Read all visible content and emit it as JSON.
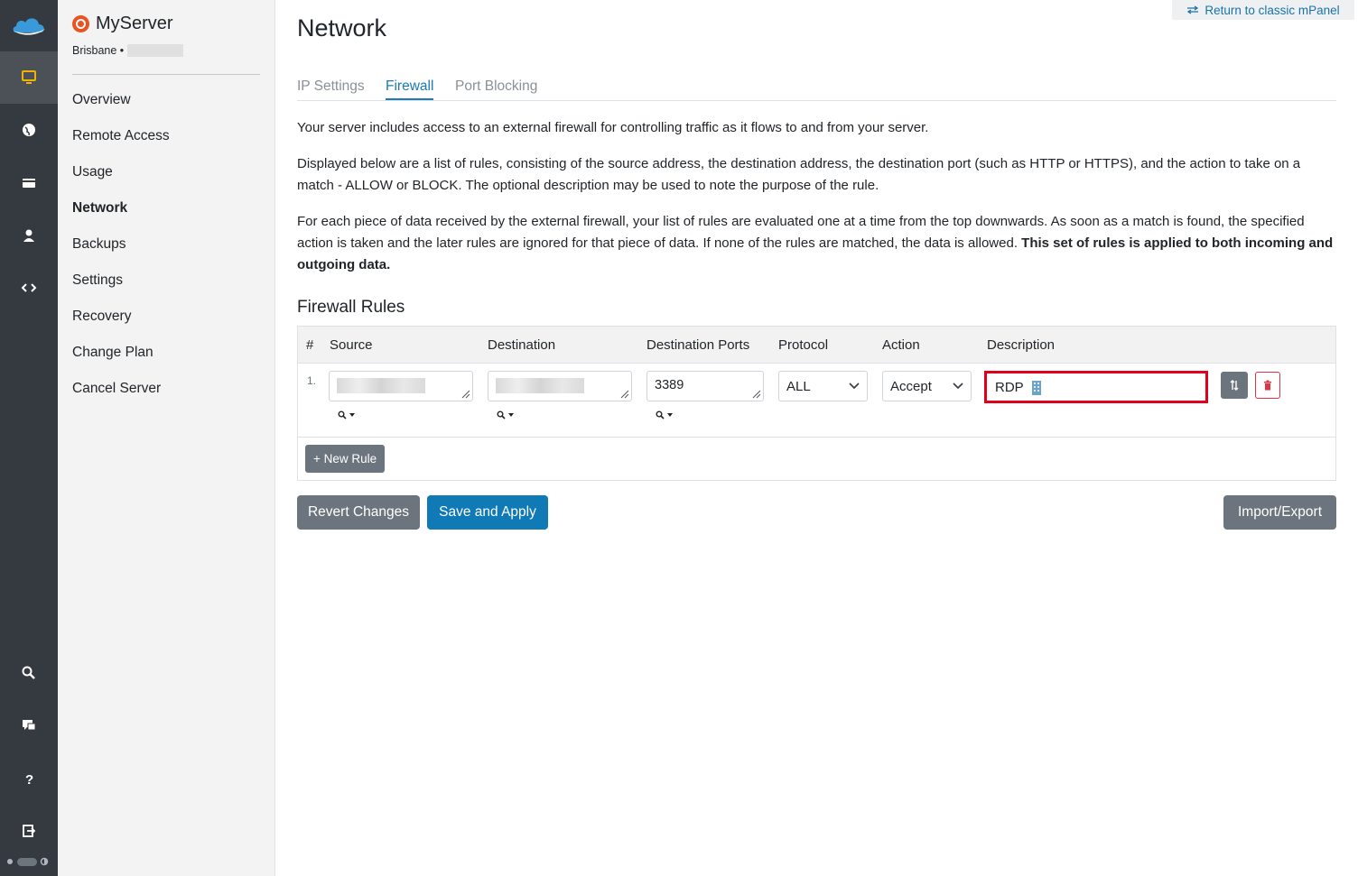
{
  "rail": {
    "items": [
      "monitor-icon",
      "globe-icon",
      "billing-icon",
      "user-icon",
      "code-icon"
    ],
    "bottom": [
      "search-icon",
      "chat-icon",
      "help-icon",
      "logout-icon"
    ]
  },
  "sidebar": {
    "server_name": "MyServer",
    "location": "Brisbane •",
    "items": [
      {
        "label": "Overview"
      },
      {
        "label": "Remote Access"
      },
      {
        "label": "Usage"
      },
      {
        "label": "Network",
        "active": true
      },
      {
        "label": "Backups"
      },
      {
        "label": "Settings"
      },
      {
        "label": "Recovery"
      },
      {
        "label": "Change Plan"
      },
      {
        "label": "Cancel Server"
      }
    ]
  },
  "header": {
    "return_link": "Return to classic mPanel",
    "title": "Network"
  },
  "tabs": [
    {
      "label": "IP Settings"
    },
    {
      "label": "Firewall",
      "active": true
    },
    {
      "label": "Port Blocking"
    }
  ],
  "intro": {
    "p1": "Your server includes access to an external firewall for controlling traffic as it flows to and from your server.",
    "p2": "Displayed below are a list of rules, consisting of the source address, the destination address, the destination port (such as HTTP or HTTPS), and the action to take on a match - ALLOW or BLOCK. The optional description may be used to note the purpose of the rule.",
    "p3": "For each piece of data received by the external firewall, your list of rules are evaluated one at a time from the top downwards. As soon as a match is found, the specified action is taken and the later rules are ignored for that piece of data. If none of the rules are matched, the data is allowed.",
    "p3_bold": "This set of rules is applied to both incoming and outgoing data."
  },
  "firewall": {
    "section_title": "Firewall Rules",
    "columns": [
      "#",
      "Source",
      "Destination",
      "Destination Ports",
      "Protocol",
      "Action",
      "Description"
    ],
    "rules": [
      {
        "num": "1.",
        "source": "",
        "destination": "",
        "ports": "3389",
        "protocol": "ALL",
        "action": "Accept",
        "description": "RDP"
      }
    ],
    "new_rule_label": "+ New Rule"
  },
  "buttons": {
    "revert": "Revert Changes",
    "save": "Save and Apply",
    "import_export": "Import/Export"
  },
  "colors": {
    "accent": "#0f7ab5",
    "rail_bg": "#343a40",
    "highlight": "#e0001b",
    "active_icon": "#f0b400"
  }
}
